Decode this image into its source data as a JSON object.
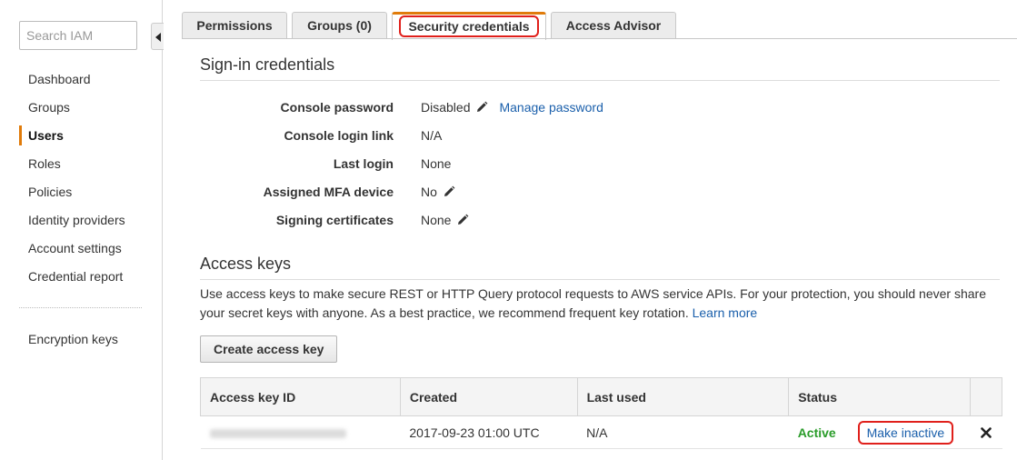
{
  "sidebar": {
    "search_placeholder": "Search IAM",
    "items": [
      {
        "label": "Dashboard"
      },
      {
        "label": "Groups"
      },
      {
        "label": "Users",
        "active": true
      },
      {
        "label": "Roles"
      },
      {
        "label": "Policies"
      },
      {
        "label": "Identity providers"
      },
      {
        "label": "Account settings"
      },
      {
        "label": "Credential report"
      }
    ],
    "extra_item": "Encryption keys"
  },
  "tabs": [
    {
      "label": "Permissions"
    },
    {
      "label": "Groups (0)"
    },
    {
      "label": "Security credentials",
      "active": true
    },
    {
      "label": "Access Advisor"
    }
  ],
  "signin": {
    "title": "Sign-in credentials",
    "rows": [
      {
        "label": "Console password",
        "value": "Disabled",
        "link": "Manage password"
      },
      {
        "label": "Console login link",
        "value": "N/A"
      },
      {
        "label": "Last login",
        "value": "None"
      },
      {
        "label": "Assigned MFA device",
        "value": "No"
      },
      {
        "label": "Signing certificates",
        "value": "None"
      }
    ]
  },
  "access_keys": {
    "title": "Access keys",
    "description": "Use access keys to make secure REST or HTTP Query protocol requests to AWS service APIs. For your protection, you should never share your secret keys with anyone. As a best practice, we recommend frequent key rotation.",
    "learn_more": "Learn more",
    "create_button": "Create access key",
    "columns": [
      "Access key ID",
      "Created",
      "Last used",
      "Status"
    ],
    "rows": [
      {
        "created": "2017-09-23 01:00 UTC",
        "last_used": "N/A",
        "status": "Active",
        "action": "Make inactive"
      }
    ]
  },
  "colors": {
    "accent": "#e07b0a",
    "link": "#1a5fab",
    "active_status": "#2a9c2a",
    "highlight": "#e0201b"
  },
  "icons": {
    "edit": "pencil-icon",
    "delete": "close-icon",
    "collapse": "chevron-left-icon"
  }
}
